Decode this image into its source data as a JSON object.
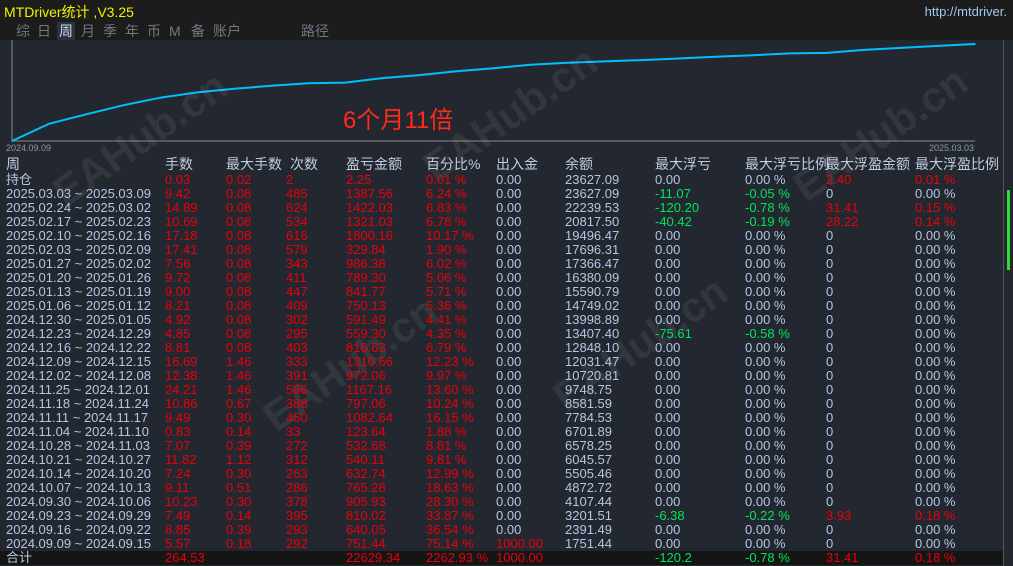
{
  "window": {
    "title": "MTDriver统计 ,V3.25",
    "url": "http://mtdriver."
  },
  "tabs": [
    "综",
    "日",
    "周",
    "月",
    "季",
    "年",
    "币",
    "M",
    "备",
    "账户",
    "路径"
  ],
  "selected_tab": "周",
  "annotation": "6个月11倍",
  "watermark": "EAHub.cn",
  "colors": {
    "accent": "#00bfff",
    "profit": "#e8000b",
    "loss": "#00e35c",
    "text": "#b4c6e4",
    "title": "#f2f200"
  },
  "chart_data": {
    "type": "line",
    "title": "",
    "x_start_label": "2024.09.09",
    "x_end_label": "2025.03.03",
    "scale": "log",
    "x": [
      "2024.09.09",
      "2024.09.16",
      "2024.09.23",
      "2024.09.30",
      "2024.10.07",
      "2024.10.14",
      "2024.10.21",
      "2024.10.28",
      "2024.11.04",
      "2024.11.11",
      "2024.11.18",
      "2024.11.25",
      "2024.12.02",
      "2024.12.09",
      "2024.12.16",
      "2024.12.23",
      "2024.12.30",
      "2025.01.06",
      "2025.01.13",
      "2025.01.20",
      "2025.01.27",
      "2025.02.03",
      "2025.02.10",
      "2025.02.17",
      "2025.02.24",
      "2025.03.03"
    ],
    "values": [
      1000,
      1751.44,
      2391.49,
      3201.51,
      4107.44,
      4872.72,
      5505.46,
      6045.57,
      6578.25,
      6701.89,
      7784.53,
      8581.59,
      9748.75,
      10720.81,
      12031.47,
      12848.1,
      13407.4,
      13998.89,
      14749.02,
      15590.79,
      16380.09,
      17366.47,
      17696.31,
      19496.47,
      20817.5,
      22239.53,
      23627.09
    ]
  },
  "table": {
    "headers": [
      "周",
      "手数",
      "最大手数",
      "次数",
      "盈亏金额",
      "百分比%",
      "出入金",
      "余额",
      "最大浮亏",
      "最大浮亏比例",
      "最大浮盈金额",
      "最大浮盈比例"
    ],
    "rows": [
      [
        "持仓",
        "0.03",
        "0.02",
        "2",
        "2.25",
        "0.01 %",
        "0.00",
        "23627.09",
        "0.00",
        "0.00 %",
        "2.40",
        "0.01 %"
      ],
      [
        "2025.03.03 ~ 2025.03.09",
        "9.42",
        "0.08",
        "485",
        "1387.56",
        "6.24 %",
        "0.00",
        "23627.09",
        "-11.07",
        "-0.05 %",
        "0",
        "0.00 %"
      ],
      [
        "2025.02.24 ~ 2025.03.02",
        "14.89",
        "0.08",
        "624",
        "1422.03",
        "6.83 %",
        "0.00",
        "22239.53",
        "-120.20",
        "-0.78 %",
        "31.41",
        "0.15 %"
      ],
      [
        "2025.02.17 ~ 2025.02.23",
        "10.69",
        "0.08",
        "534",
        "1321.03",
        "6.78 %",
        "0.00",
        "20817.50",
        "-40.42",
        "-0.19 %",
        "28.22",
        "0.14 %"
      ],
      [
        "2025.02.10 ~ 2025.02.16",
        "17.18",
        "0.08",
        "616",
        "1800.16",
        "10.17 %",
        "0.00",
        "19496.47",
        "0.00",
        "0.00 %",
        "0",
        "0.00 %"
      ],
      [
        "2025.02.03 ~ 2025.02.09",
        "17.41",
        "0.08",
        "579",
        "329.84",
        "1.90 %",
        "0.00",
        "17696.31",
        "0.00",
        "0.00 %",
        "0",
        "0.00 %"
      ],
      [
        "2025.01.27 ~ 2025.02.02",
        "7.56",
        "0.08",
        "343",
        "986.38",
        "6.02 %",
        "0.00",
        "17366.47",
        "0.00",
        "0.00 %",
        "0",
        "0.00 %"
      ],
      [
        "2025.01.20 ~ 2025.01.26",
        "9.72",
        "0.08",
        "411",
        "789.30",
        "5.06 %",
        "0.00",
        "16380.09",
        "0.00",
        "0.00 %",
        "0",
        "0.00 %"
      ],
      [
        "2025.01.13 ~ 2025.01.19",
        "9.00",
        "0.08",
        "447",
        "841.77",
        "5.71 %",
        "0.00",
        "15590.79",
        "0.00",
        "0.00 %",
        "0",
        "0.00 %"
      ],
      [
        "2025.01.06 ~ 2025.01.12",
        "8.21",
        "0.08",
        "409",
        "750.13",
        "5.36 %",
        "0.00",
        "14749.02",
        "0.00",
        "0.00 %",
        "0",
        "0.00 %"
      ],
      [
        "2024.12.30 ~ 2025.01.05",
        "4.92",
        "0.08",
        "302",
        "591.49",
        "4.41 %",
        "0.00",
        "13998.89",
        "0.00",
        "0.00 %",
        "0",
        "0.00 %"
      ],
      [
        "2024.12.23 ~ 2024.12.29",
        "4.85",
        "0.08",
        "295",
        "559.30",
        "4.35 %",
        "0.00",
        "13407.40",
        "-75.61",
        "-0.58 %",
        "0",
        "0.00 %"
      ],
      [
        "2024.12.16 ~ 2024.12.22",
        "8.81",
        "0.08",
        "403",
        "816.63",
        "6.79 %",
        "0.00",
        "12848.10",
        "0.00",
        "0.00 %",
        "0",
        "0.00 %"
      ],
      [
        "2024.12.09 ~ 2024.12.15",
        "16.69",
        "1.46",
        "333",
        "1310.66",
        "12.23 %",
        "0.00",
        "12031.47",
        "0.00",
        "0.00 %",
        "0",
        "0.00 %"
      ],
      [
        "2024.12.02 ~ 2024.12.08",
        "12.38",
        "1.46",
        "391",
        "972.06",
        "9.97 %",
        "0.00",
        "10720.81",
        "0.00",
        "0.00 %",
        "0",
        "0.00 %"
      ],
      [
        "2024.11.25 ~ 2024.12.01",
        "24.21",
        "1.46",
        "586",
        "1167.16",
        "13.60 %",
        "0.00",
        "9748.75",
        "0.00",
        "0.00 %",
        "0",
        "0.00 %"
      ],
      [
        "2024.11.18 ~ 2024.11.24",
        "10.86",
        "0.67",
        "388",
        "797.06",
        "10.24 %",
        "0.00",
        "8581.59",
        "0.00",
        "0.00 %",
        "0",
        "0.00 %"
      ],
      [
        "2024.11.11 ~ 2024.11.17",
        "9.49",
        "0.30",
        "450",
        "1082.64",
        "16.15 %",
        "0.00",
        "7784.53",
        "0.00",
        "0.00 %",
        "0",
        "0.00 %"
      ],
      [
        "2024.11.04 ~ 2024.11.10",
        "0.83",
        "0.14",
        "33",
        "123.64",
        "1.88 %",
        "0.00",
        "6701.89",
        "0.00",
        "0.00 %",
        "0",
        "0.00 %"
      ],
      [
        "2024.10.28 ~ 2024.11.03",
        "7.07",
        "0.39",
        "272",
        "532.68",
        "8.81 %",
        "0.00",
        "6578.25",
        "0.00",
        "0.00 %",
        "0",
        "0.00 %"
      ],
      [
        "2024.10.21 ~ 2024.10.27",
        "11.82",
        "1.12",
        "312",
        "540.11",
        "9.81 %",
        "0.00",
        "6045.57",
        "0.00",
        "0.00 %",
        "0",
        "0.00 %"
      ],
      [
        "2024.10.14 ~ 2024.10.20",
        "7.24",
        "0.30",
        "263",
        "632.74",
        "12.99 %",
        "0.00",
        "5505.46",
        "0.00",
        "0.00 %",
        "0",
        "0.00 %"
      ],
      [
        "2024.10.07 ~ 2024.10.13",
        "9.11",
        "0.51",
        "286",
        "765.28",
        "18.63 %",
        "0.00",
        "4872.72",
        "0.00",
        "0.00 %",
        "0",
        "0.00 %"
      ],
      [
        "2024.09.30 ~ 2024.10.06",
        "10.23",
        "0.30",
        "378",
        "905.93",
        "28.30 %",
        "0.00",
        "4107.44",
        "0.00",
        "0.00 %",
        "0",
        "0.00 %"
      ],
      [
        "2024.09.23 ~ 2024.09.29",
        "7.49",
        "0.14",
        "395",
        "810.02",
        "33.87 %",
        "0.00",
        "3201.51",
        "-6.38",
        "-0.22 %",
        "3.93",
        "0.18 %"
      ],
      [
        "2024.09.16 ~ 2024.09.22",
        "8.85",
        "0.39",
        "293",
        "640.05",
        "36.54 %",
        "0.00",
        "2391.49",
        "0.00",
        "0.00 %",
        "0",
        "0.00 %"
      ],
      [
        "2024.09.09 ~ 2024.09.15",
        "5.57",
        "0.18",
        "292",
        "751.44",
        "75.14 %",
        "1000.00",
        "1751.44",
        "0.00",
        "0.00 %",
        "0",
        "0.00 %"
      ]
    ],
    "total": [
      "合计",
      "264.53",
      "",
      "",
      "22629.34",
      "2262.93 %",
      "1000.00",
      "",
      "-120.2",
      "-0.78 %",
      "31.41",
      "0.18 %"
    ]
  }
}
